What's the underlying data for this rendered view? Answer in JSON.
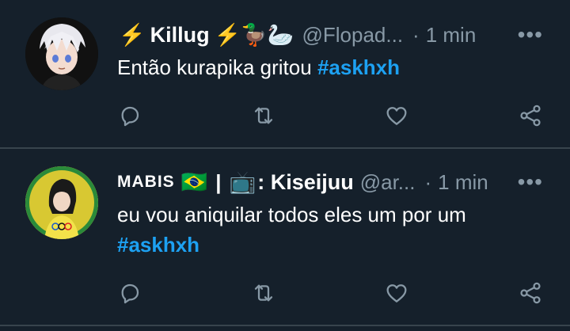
{
  "colors": {
    "background": "#15202b",
    "text": "#ffffff",
    "muted": "#8899a6",
    "accent": "#1da1f2",
    "divider": "#38444d"
  },
  "tweets": [
    {
      "name_prefix_emoji": "⚡",
      "name": "Killug",
      "name_suffix_emoji": "⚡🦆🦢",
      "handle": "@Flopad...",
      "separator": "·",
      "time": "1 min",
      "more": "•••",
      "text": "Então kurapika gritou ",
      "hashtag": "#askhxh",
      "avatar_icon": "anime-avatar-icon",
      "actions": [
        "reply-icon",
        "retweet-icon",
        "like-icon",
        "share-icon"
      ]
    },
    {
      "name": "MABIS",
      "flag": "🇧🇷",
      "bar": "|",
      "tv": "📺",
      "name_rest": ": Kiseijuu",
      "handle": "@ar...",
      "separator": "·",
      "time": "1 min",
      "more": "•••",
      "text": "eu vou aniquilar todos eles um por um",
      "hashtag": "#askhxh",
      "avatar_icon": "anime-avatar-icon",
      "actions": [
        "reply-icon",
        "retweet-icon",
        "like-icon",
        "share-icon"
      ]
    }
  ]
}
